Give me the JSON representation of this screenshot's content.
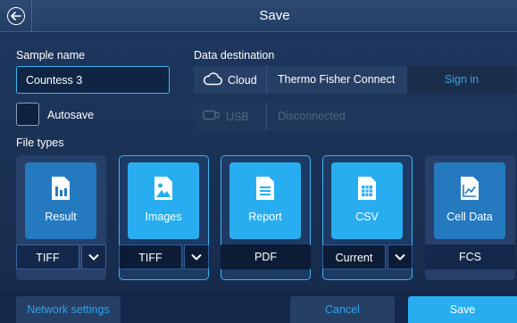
{
  "header": {
    "title": "Save"
  },
  "sample": {
    "label": "Sample name",
    "value": "Countess 3"
  },
  "autosave": {
    "label": "Autosave"
  },
  "destination": {
    "label": "Data destination",
    "cloud": {
      "name": "Cloud",
      "service": "Thermo Fisher Connect",
      "sign_in": "Sign in",
      "icon": "cloud-icon"
    },
    "usb": {
      "name": "USB",
      "status": "Disconnected",
      "icon": "usb-icon"
    }
  },
  "file_types": {
    "label": "File types",
    "items": [
      {
        "label": "Result",
        "format": "TIFF",
        "icon": "bar-chart-icon",
        "selected": false
      },
      {
        "label": "Images",
        "format": "TIFF",
        "icon": "image-icon",
        "selected": true
      },
      {
        "label": "Report",
        "format": "PDF",
        "icon": "document-icon",
        "selected": true
      },
      {
        "label": "CSV",
        "format": "Current",
        "icon": "spreadsheet-icon",
        "selected": true
      },
      {
        "label": "Cell Data",
        "format": "FCS",
        "icon": "line-chart-icon",
        "selected": false
      }
    ]
  },
  "footer": {
    "network_settings": "Network settings",
    "cancel": "Cancel",
    "save": "Save"
  },
  "colors": {
    "accent": "#28aef0",
    "link": "#2fa4ea",
    "background": "#1b3357"
  }
}
